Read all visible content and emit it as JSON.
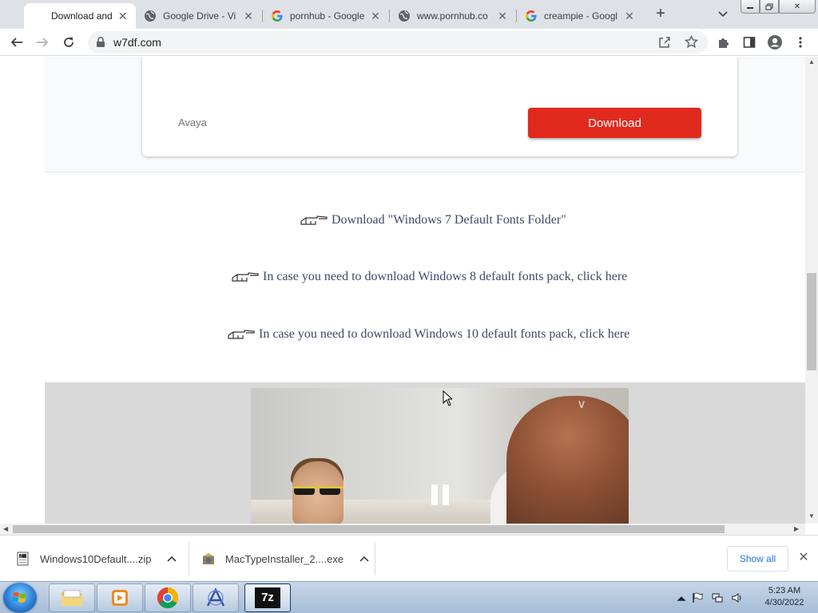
{
  "browser": {
    "tabs": [
      {
        "title": "Download and Re",
        "icon": "page-icon",
        "active": true
      },
      {
        "title": "Google Drive - Vi",
        "icon": "globe-icon",
        "active": false
      },
      {
        "title": "pornhub - Google",
        "icon": "google-icon",
        "active": false
      },
      {
        "title": "www.pornhub.co",
        "icon": "globe-icon",
        "active": false
      },
      {
        "title": "creampie - Googl",
        "icon": "google-icon",
        "active": false
      }
    ],
    "new_tab_label": "+",
    "url": "w7df.com"
  },
  "page": {
    "ad": {
      "advertiser": "Avaya",
      "button_label": "Download",
      "button_color": "#e02a1e"
    },
    "links": [
      "Download \"Windows 7 Default Fonts Folder\"",
      "In case you need to download Windows 8 default fonts pack, click here",
      "In case you need to download Windows 10 default fonts pack, click here"
    ],
    "video": {
      "state": "playing",
      "watermark": "V"
    }
  },
  "downloads": {
    "items": [
      {
        "name": "Windows10Default....zip",
        "icon": "zip-file-icon"
      },
      {
        "name": "MacTypeInstaller_2....exe",
        "icon": "installer-icon"
      }
    ],
    "show_all_label": "Show all"
  },
  "taskbar": {
    "apps": [
      "explorer-icon",
      "media-player-icon",
      "chrome-icon",
      "app-icon",
      "7zip-icon"
    ],
    "sevenzip_label": "7z",
    "time": "5:23 AM",
    "date": "4/30/2022"
  }
}
